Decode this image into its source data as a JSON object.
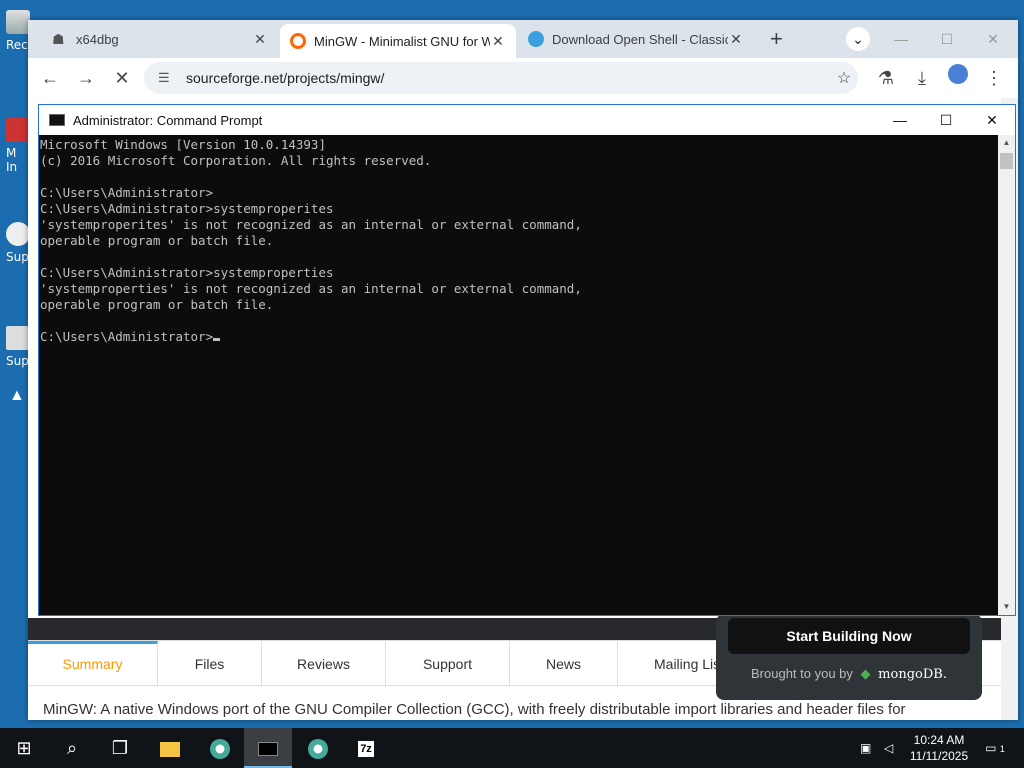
{
  "desktop": {
    "icons": [
      {
        "label": "Rec"
      },
      {
        "label": "M In"
      },
      {
        "label": "Sup"
      },
      {
        "label": "Sup"
      }
    ]
  },
  "browser": {
    "tabs": [
      {
        "title": "x64dbg",
        "icon": "bug-icon"
      },
      {
        "title": "MinGW - Minimalist GNU for W",
        "icon": "sourceforge-icon",
        "active": true
      },
      {
        "title": "Download Open Shell - Classic",
        "icon": "shell-icon"
      }
    ],
    "url": "sourceforge.net/projects/mingw/",
    "page": {
      "tabs": [
        "Summary",
        "Files",
        "Reviews",
        "Support",
        "News",
        "Mailing Lis"
      ],
      "active_tab": "Summary",
      "description": "MinGW: A native Windows port of the GNU Compiler Collection (GCC), with freely distributable import libraries and header files for",
      "promo": {
        "cta": "Start Building Now",
        "brought": "Brought to you by",
        "brand": "mongoDB."
      }
    }
  },
  "cmd": {
    "title": "Administrator: Command Prompt",
    "lines": [
      "Microsoft Windows [Version 10.0.14393]",
      "(c) 2016 Microsoft Corporation. All rights reserved.",
      "",
      "C:\\Users\\Administrator>",
      "C:\\Users\\Administrator>systemproperites",
      "'systemproperites' is not recognized as an internal or external command,",
      "operable program or batch file.",
      "",
      "C:\\Users\\Administrator>systemproperties",
      "'systemproperties' is not recognized as an internal or external command,",
      "operable program or batch file.",
      "",
      "C:\\Users\\Administrator>"
    ]
  },
  "taskbar": {
    "time": "10:24 AM",
    "date": "11/11/2025",
    "notification_count": "1"
  },
  "colors": {
    "accent_orange": "#ff9900",
    "cmd_text": "#c0c0c0",
    "desktop_blue": "#1c6db0"
  }
}
